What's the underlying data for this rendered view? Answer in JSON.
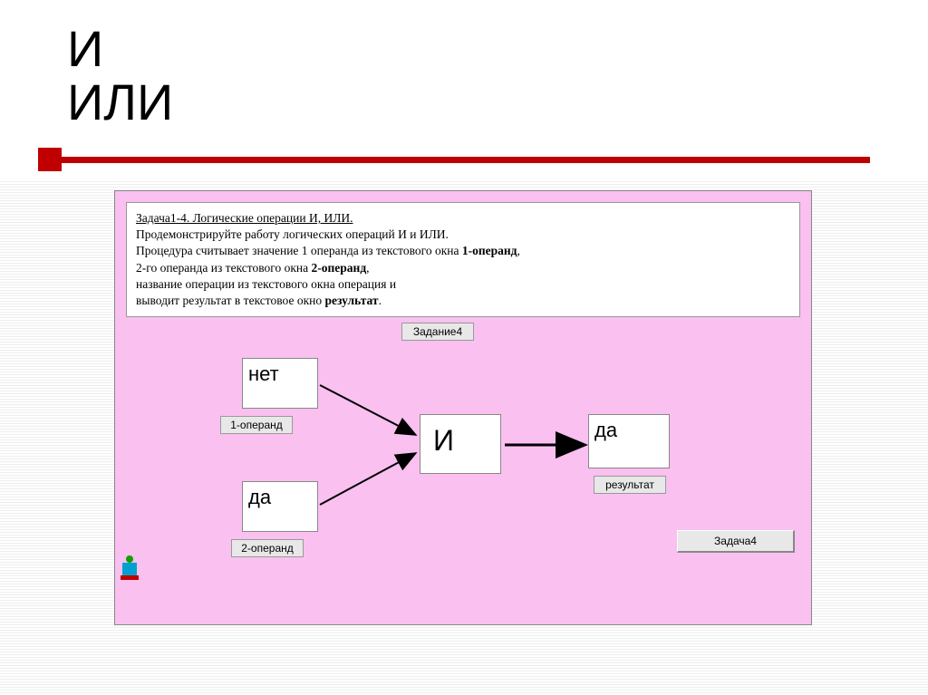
{
  "title": {
    "line1": "И",
    "line2": "ИЛИ"
  },
  "panel": {
    "task": {
      "link_text": "Задача1-4. Логические операции И, ИЛИ.",
      "line1": "Продемонстрируйте работу логических операций И и ИЛИ.",
      "line2a": "Процедура считывает значение 1 операнда из текстового окна ",
      "line2b": "1-операнд",
      "line2c": ",",
      "line3a": "2-го операнда из текстового окна ",
      "line3b": "2-операнд",
      "line3c": ",",
      "line4": "название операции из текстового окна операция  и",
      "line5a": " выводит результат в текстовое окно ",
      "line5b": "результат",
      "line5c": "."
    },
    "labels": {
      "zadanie4": "Задание4",
      "operand1": "1-операнд",
      "operand2": "2-операнд",
      "result": "результат",
      "button_task4": "Задача4"
    },
    "values": {
      "operand1": "нет",
      "operand2": "да",
      "operation": "И",
      "result": "да"
    }
  }
}
